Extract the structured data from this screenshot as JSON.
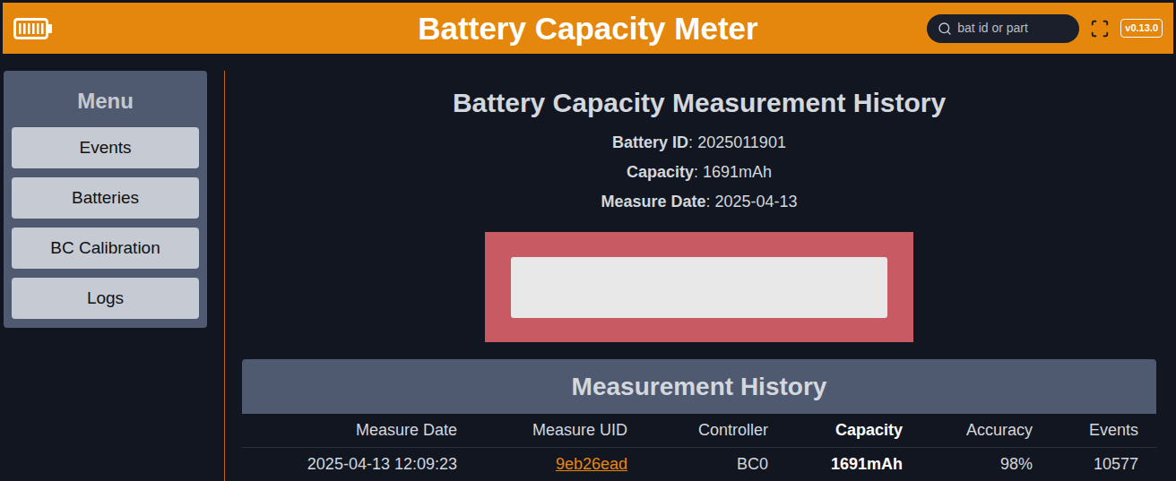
{
  "header": {
    "title": "Battery Capacity Meter",
    "search": {
      "placeholder": "bat id or part"
    },
    "version": "v0.13.0"
  },
  "sidebar": {
    "title": "Menu",
    "items": [
      "Events",
      "Batteries",
      "BC Calibration",
      "Logs"
    ]
  },
  "page": {
    "title": "Battery Capacity Measurement History",
    "fields": [
      {
        "label": "Battery ID",
        "value": "2025011901"
      },
      {
        "label": "Capacity",
        "value": "1691mAh"
      },
      {
        "label": "Measure Date",
        "value": "2025-04-13"
      }
    ]
  },
  "table": {
    "title": "Measurement History",
    "columns": [
      {
        "label": "Measure Date",
        "emphasized": false
      },
      {
        "label": "Measure UID",
        "emphasized": false
      },
      {
        "label": "Controller",
        "emphasized": false
      },
      {
        "label": "Capacity",
        "emphasized": true
      },
      {
        "label": "Accuracy",
        "emphasized": false
      },
      {
        "label": "Events",
        "emphasized": false
      }
    ],
    "rows": [
      [
        {
          "text": "2025-04-13 12:09:23",
          "kind": "text"
        },
        {
          "text": "9eb26ead",
          "kind": "link"
        },
        {
          "text": "BC0",
          "kind": "text"
        },
        {
          "text": "1691mAh",
          "kind": "bold"
        },
        {
          "text": "98%",
          "kind": "text"
        },
        {
          "text": "10577",
          "kind": "text"
        }
      ]
    ]
  }
}
